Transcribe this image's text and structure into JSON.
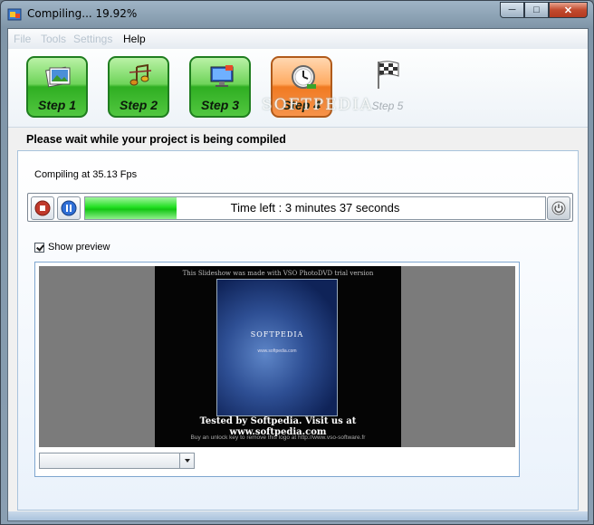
{
  "window": {
    "title": "Compiling... 19.92%"
  },
  "menu": {
    "file": "File",
    "tools": "Tools",
    "settings": "Settings",
    "help": "Help"
  },
  "steps": [
    {
      "label": "Step 1",
      "icon": "photos-icon"
    },
    {
      "label": "Step 2",
      "icon": "music-icon"
    },
    {
      "label": "Step 3",
      "icon": "monitor-icon"
    },
    {
      "label": "Step 4",
      "icon": "clock-icon",
      "active": true
    },
    {
      "label": "Step 5",
      "icon": "checkered-flag-icon"
    }
  ],
  "watermark": "SOFTPEDIA",
  "heading": "Please wait while your project is being compiled",
  "compiling_status": "Compiling at 35.13 Fps",
  "progress": {
    "percent": 19.92,
    "time_left": "Time left :  3 minutes 37 seconds"
  },
  "preview": {
    "checkbox_label": "Show preview",
    "checked": true,
    "video_top_text": "This Slideshow was made with VSO PhotoDVD trial version",
    "cover_title": "SOFTPEDIA",
    "cover_url": "www.softpedia.com",
    "tested_line1": "Tested by Softpedia. Visit us at",
    "tested_line2": "www.softpedia.com",
    "bottom_text": "Buy an unlock key to remove this logo at http://www.vso-software.fr"
  },
  "colors": {
    "progress_green": "#22e022",
    "step_green": "#2fae22",
    "step_active_orange": "#f07a22"
  }
}
